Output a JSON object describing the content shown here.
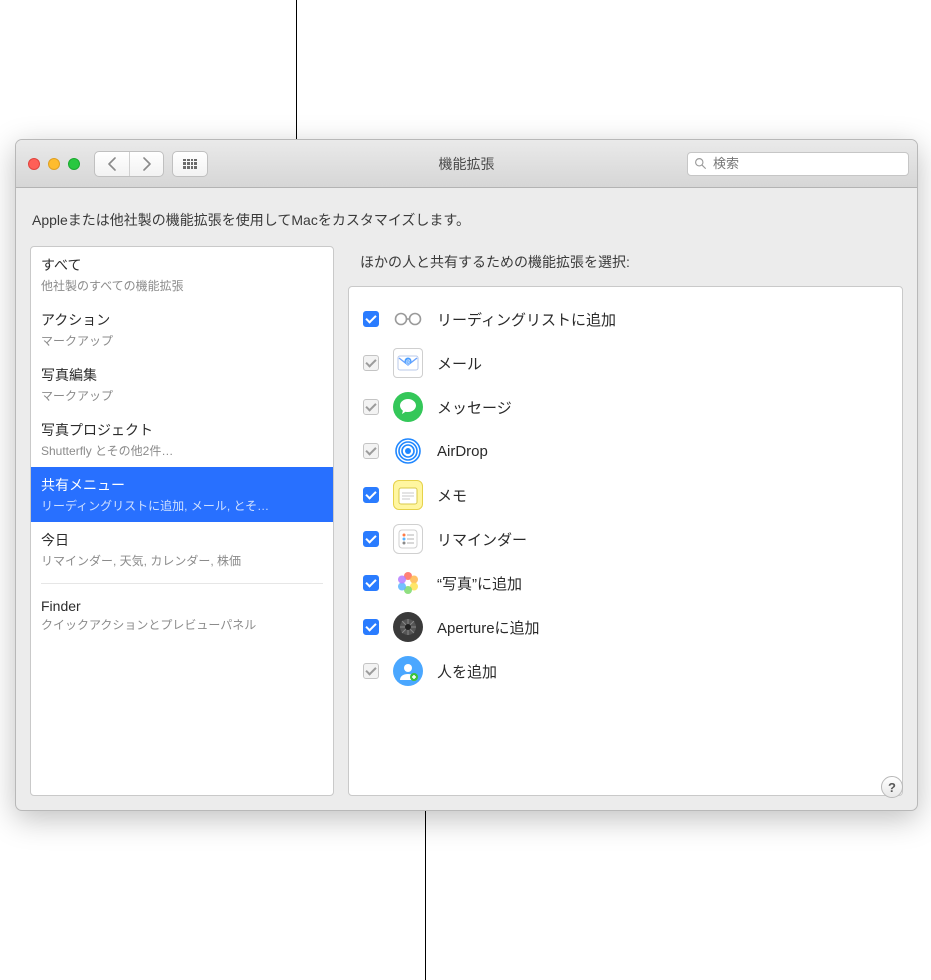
{
  "window": {
    "title": "機能拡張",
    "search_placeholder": "検索"
  },
  "subtitle": "Appleまたは他社製の機能拡張を使用してMacをカスタマイズします。",
  "sidebar": {
    "categories": [
      {
        "title": "すべて",
        "subtitle": "他社製のすべての機能拡張"
      },
      {
        "title": "アクション",
        "subtitle": "マークアップ"
      },
      {
        "title": "写真編集",
        "subtitle": "マークアップ"
      },
      {
        "title": "写真プロジェクト",
        "subtitle": "Shutterfly とその他2件…"
      },
      {
        "title": "共有メニュー",
        "subtitle": "リーディングリストに追加, メール, とそ…"
      },
      {
        "title": "今日",
        "subtitle": "リマインダー, 天気, カレンダー, 株価"
      },
      {
        "title": "Finder",
        "subtitle": "クイックアクションとプレビューパネル"
      }
    ],
    "selected_index": 4
  },
  "detail": {
    "heading": "ほかの人と共有するための機能拡張を選択:",
    "items": [
      {
        "label": "リーディングリストに追加",
        "checked": true,
        "disabled": false,
        "icon": "glasses"
      },
      {
        "label": "メール",
        "checked": true,
        "disabled": true,
        "icon": "mail"
      },
      {
        "label": "メッセージ",
        "checked": true,
        "disabled": true,
        "icon": "messages"
      },
      {
        "label": "AirDrop",
        "checked": true,
        "disabled": true,
        "icon": "airdrop"
      },
      {
        "label": "メモ",
        "checked": true,
        "disabled": false,
        "icon": "notes"
      },
      {
        "label": "リマインダー",
        "checked": true,
        "disabled": false,
        "icon": "reminders"
      },
      {
        "label": "“写真”に追加",
        "checked": true,
        "disabled": false,
        "icon": "photos"
      },
      {
        "label": "Apertureに追加",
        "checked": true,
        "disabled": false,
        "icon": "aperture"
      },
      {
        "label": "人を追加",
        "checked": true,
        "disabled": true,
        "icon": "people"
      }
    ]
  },
  "help_label": "?"
}
